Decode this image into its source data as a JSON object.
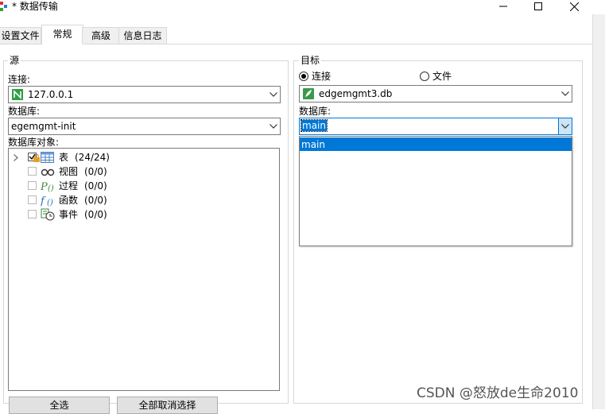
{
  "window": {
    "title": "* 数据传输"
  },
  "tabs": [
    {
      "label": "设置文件",
      "active": false
    },
    {
      "label": "常规",
      "active": true
    },
    {
      "label": "高级",
      "active": false
    },
    {
      "label": "信息日志",
      "active": false
    }
  ],
  "source": {
    "group_title": "源",
    "connection_label": "连接:",
    "connection_value": "127.0.0.1",
    "database_label": "数据库:",
    "database_value": "egemgmt-init",
    "objects_label": "数据库对象:",
    "tree": [
      {
        "label": "表",
        "count": "(24/24)",
        "icon": "table-icon",
        "checked": "partial",
        "expandable": true
      },
      {
        "label": "视图",
        "count": "(0/0)",
        "icon": "view-icon",
        "checked": false
      },
      {
        "label": "过程",
        "count": "(0/0)",
        "icon": "procedure-icon",
        "checked": false
      },
      {
        "label": "函数",
        "count": "(0/0)",
        "icon": "function-icon",
        "checked": false
      },
      {
        "label": "事件",
        "count": "(0/0)",
        "icon": "event-icon",
        "checked": false
      }
    ],
    "select_all_label": "全选",
    "deselect_all_label": "全部取消选择"
  },
  "target": {
    "group_title": "目标",
    "radio_connection_label": "连接",
    "radio_file_label": "文件",
    "selected_radio": "连接",
    "connection_value": "edgemgmt3.db",
    "database_label": "数据库:",
    "database_value": "main",
    "dropdown_options": [
      "main"
    ]
  },
  "watermark": "CSDN @怒放de生命2010",
  "colors": {
    "accent": "#0078d7",
    "connection_icon_green": "#2f9e44"
  }
}
